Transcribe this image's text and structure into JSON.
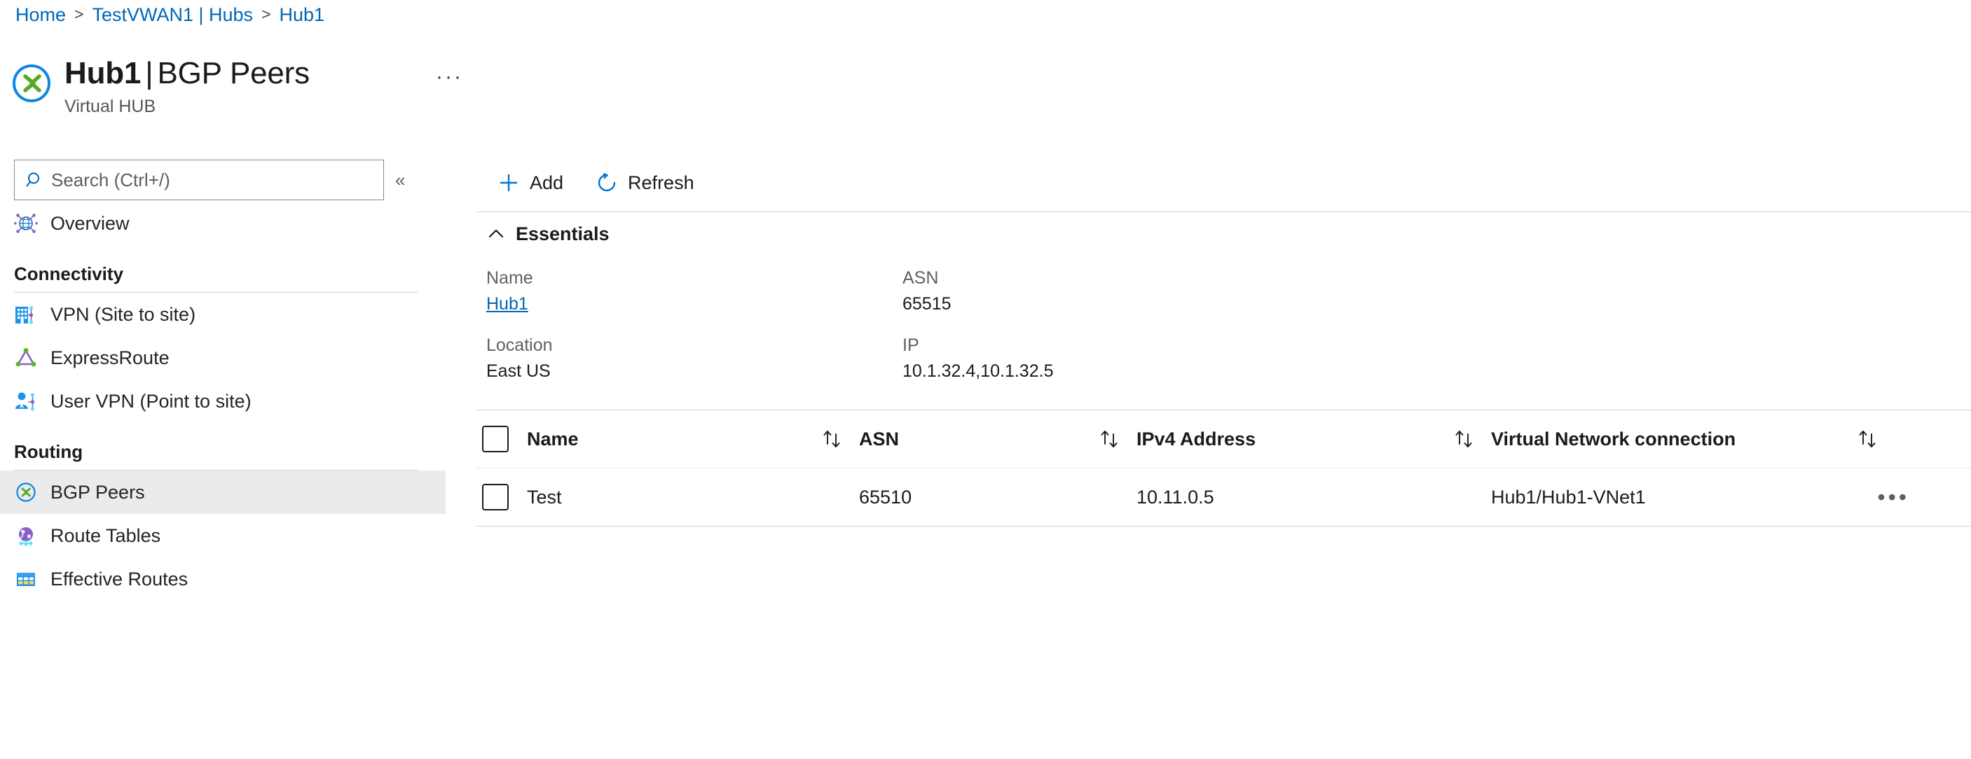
{
  "breadcrumb": {
    "items": [
      {
        "label": "Home"
      },
      {
        "label": "TestVWAN1 | Hubs"
      },
      {
        "label": "Hub1"
      }
    ],
    "separator": ">"
  },
  "header": {
    "resource_name": "Hub1",
    "separator": "|",
    "blade_name": "BGP Peers",
    "subtitle": "Virtual HUB",
    "more_label": "···",
    "icon": "virtual-hub-icon"
  },
  "sidebar": {
    "search": {
      "placeholder": "Search (Ctrl+/)",
      "value": "",
      "icon": "search-icon"
    },
    "collapse_label": "«",
    "top_items": [
      {
        "label": "Overview",
        "icon": "overview-globe-icon",
        "selected": false
      }
    ],
    "sections": [
      {
        "title": "Connectivity",
        "items": [
          {
            "label": "VPN (Site to site)",
            "icon": "vpn-site-icon",
            "selected": false
          },
          {
            "label": "ExpressRoute",
            "icon": "expressroute-icon",
            "selected": false
          },
          {
            "label": "User VPN (Point to site)",
            "icon": "user-vpn-icon",
            "selected": false
          }
        ]
      },
      {
        "title": "Routing",
        "items": [
          {
            "label": "BGP Peers",
            "icon": "bgp-peers-icon",
            "selected": true
          },
          {
            "label": "Route Tables",
            "icon": "route-tables-icon",
            "selected": false
          },
          {
            "label": "Effective Routes",
            "icon": "effective-routes-icon",
            "selected": false
          }
        ]
      }
    ]
  },
  "toolbar": {
    "add_label": "Add",
    "add_icon": "plus-icon",
    "refresh_label": "Refresh",
    "refresh_icon": "refresh-icon"
  },
  "essentials": {
    "title": "Essentials",
    "chevron_icon": "chevron-up-icon",
    "fields": [
      {
        "key": "Name",
        "value": "Hub1",
        "link": true
      },
      {
        "key": "ASN",
        "value": "65515",
        "link": false
      },
      {
        "key": "Location",
        "value": "East US",
        "link": false
      },
      {
        "key": "IP",
        "value": "10.1.32.4,10.1.32.5",
        "link": false
      }
    ]
  },
  "table": {
    "columns": [
      {
        "label": "Name",
        "sortable": true
      },
      {
        "label": "ASN",
        "sortable": true
      },
      {
        "label": "IPv4 Address",
        "sortable": true
      },
      {
        "label": "Virtual Network connection",
        "sortable": true
      }
    ],
    "sort_icon": "sort-updown-icon",
    "rows": [
      {
        "selected": false,
        "name": "Test",
        "asn": "65510",
        "ipv4": "10.11.0.5",
        "vnet": "Hub1/Hub1-VNet1",
        "more_label": "•••"
      }
    ]
  },
  "colors": {
    "link": "#0067b8",
    "accent": "#0078d4",
    "selected_row_bg": "#ebebeb",
    "text": "#1b1b1b",
    "muted": "#616161"
  }
}
